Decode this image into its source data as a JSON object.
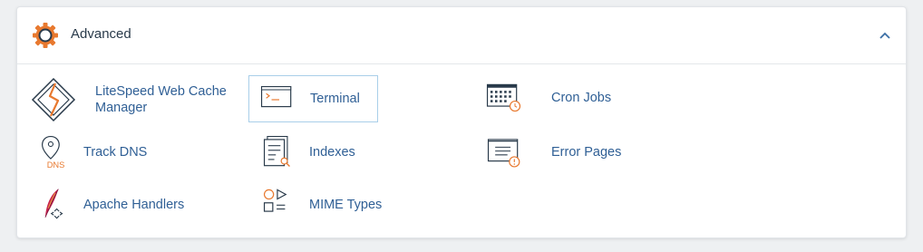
{
  "section": {
    "title": "Advanced",
    "header_icon": "gear-icon",
    "collapse_icon": "chevron-up-icon"
  },
  "tools": [
    {
      "label_line1": "LiteSpeed Web Cache",
      "label_line2": "Manager",
      "icon": "litespeed-icon"
    },
    {
      "label": "Terminal",
      "icon": "terminal-icon"
    },
    {
      "label": "Cron Jobs",
      "icon": "cron-jobs-icon"
    },
    {
      "label": "Track DNS",
      "icon": "track-dns-icon",
      "icon_text": "DNS"
    },
    {
      "label": "Indexes",
      "icon": "indexes-icon"
    },
    {
      "label": "Error Pages",
      "icon": "error-pages-icon"
    },
    {
      "label": "Apache Handlers",
      "icon": "apache-handlers-icon"
    },
    {
      "label": "MIME Types",
      "icon": "mime-types-icon"
    }
  ],
  "colors": {
    "accent_orange": "#e8792f",
    "link_blue": "#2f5f95",
    "icon_dark": "#293a4a",
    "selected_border": "#a9cfe9"
  }
}
